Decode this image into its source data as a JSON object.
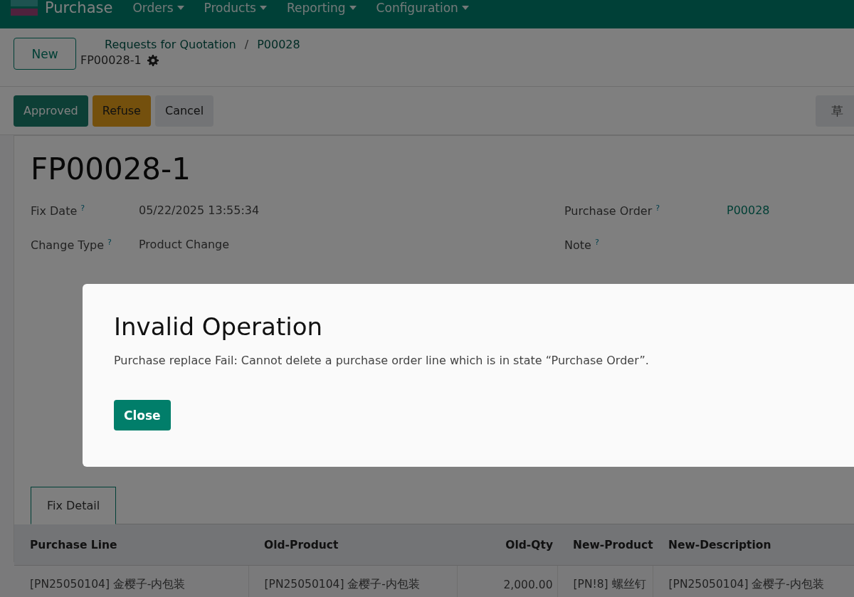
{
  "navbar": {
    "app_name": "Purchase",
    "menus": [
      "Orders",
      "Products",
      "Reporting",
      "Configuration"
    ]
  },
  "control_panel": {
    "new_button": "New",
    "breadcrumbs": [
      "Requests for Quotation",
      "P00028"
    ],
    "separator": "/",
    "record_name": "FP00028-1"
  },
  "actions": [
    {
      "label": "Approved",
      "kind": "primary"
    },
    {
      "label": "Refuse",
      "kind": "warning"
    },
    {
      "label": "Cancel",
      "kind": "secondary"
    }
  ],
  "status": {
    "label": "草"
  },
  "form": {
    "title": "FP00028-1",
    "left_fields": [
      {
        "label": "Fix Date",
        "help": "?",
        "value": "05/22/2025 13:55:34",
        "link": false
      },
      {
        "label": "Change Type",
        "help": "?",
        "value": "Product Change",
        "link": false
      }
    ],
    "right_fields": [
      {
        "label": "Purchase Order",
        "help": "?",
        "value": "P00028",
        "link": true
      },
      {
        "label": "Note",
        "help": "?"
      }
    ]
  },
  "tabs": [
    {
      "label": "Fix Detail",
      "selected": true
    }
  ],
  "table": {
    "columns": [
      {
        "label": "Purchase Line",
        "kind": "text"
      },
      {
        "label": "Old-Product",
        "kind": "text"
      },
      {
        "label": "Old-Qty",
        "kind": "number"
      },
      {
        "label": "New-Product",
        "kind": "text"
      },
      {
        "label": "New-Description",
        "kind": "text"
      }
    ],
    "rows": [
      [
        "[PN25050104] 金樱子-内包装",
        "[PN25050104] 金樱子-内包装",
        "2,000.00",
        "[PN!8] 螺丝钉",
        "[PN25050104] 金樱子-内包装"
      ]
    ]
  },
  "dialog": {
    "title": "Invalid Operation",
    "message": "Purchase replace Fail: Cannot delete a purchase order line which is in state “Purchase Order”.",
    "close_button": "Close"
  }
}
